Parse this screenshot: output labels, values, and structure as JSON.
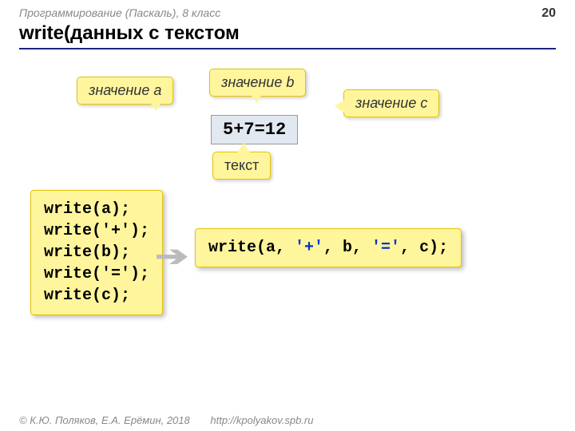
{
  "header": {
    "course": "Программирование (Паскаль), 8 класс",
    "pageNumber": "20"
  },
  "title": "write(данных с текстом",
  "callouts": {
    "a": "значение a",
    "b": "значение b",
    "c": "значение c",
    "text": "текст"
  },
  "output": "5+7=12",
  "codeLeft": "write(a);\nwrite('+');\nwrite(b);\nwrite('=');\nwrite(c);",
  "codeRight": {
    "p1": "write(a,",
    "s1": " '+'",
    "p2": ", b,",
    "s2": " '='",
    "p3": ", c);"
  },
  "footer": {
    "copyright": "© К.Ю. Поляков, Е.А. Ерёмин, 2018",
    "url": "http://kpolyakov.spb.ru"
  }
}
